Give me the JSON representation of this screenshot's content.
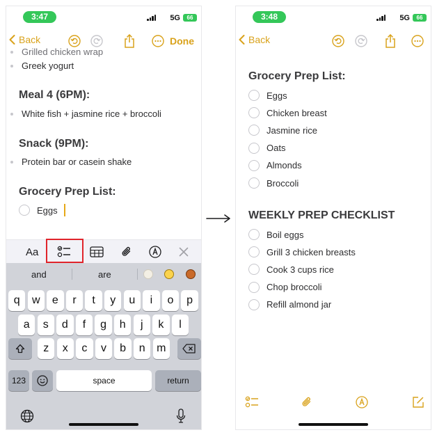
{
  "left": {
    "status": {
      "time": "3:47",
      "network": "5G",
      "battery": "66"
    },
    "nav": {
      "back": "Back",
      "done": "Done"
    },
    "bullets_top": [
      "Grilled chicken wrap",
      "Greek yogurt"
    ],
    "meal4": {
      "heading": "Meal 4 (6PM):",
      "bullet": "White fish + jasmine rice + broccoli"
    },
    "snack": {
      "heading": "Snack (9PM):",
      "bullet": "Protein bar or casein shake"
    },
    "grocery": {
      "heading": "Grocery Prep List:",
      "items": [
        "Eggs"
      ]
    },
    "format_bar": {
      "aa": "Aa"
    },
    "keyboard": {
      "suggestions": [
        "and",
        "are"
      ],
      "row1": [
        "q",
        "w",
        "e",
        "r",
        "t",
        "y",
        "u",
        "i",
        "o",
        "p"
      ],
      "row2": [
        "a",
        "s",
        "d",
        "f",
        "g",
        "h",
        "j",
        "k",
        "l"
      ],
      "row3": [
        "z",
        "x",
        "c",
        "v",
        "b",
        "n",
        "m"
      ],
      "num_key": "123",
      "space": "space",
      "return": "return"
    }
  },
  "right": {
    "status": {
      "time": "3:48",
      "network": "5G",
      "battery": "66"
    },
    "nav": {
      "back": "Back"
    },
    "grocery": {
      "heading": "Grocery Prep List:",
      "items": [
        "Eggs",
        "Chicken breast",
        "Jasmine rice",
        "Oats",
        "Almonds",
        "Broccoli"
      ]
    },
    "weekly": {
      "heading": "WEEKLY PREP CHECKLIST",
      "items": [
        "Boil eggs",
        "Grill 3 chicken breasts",
        "Cook 3 cups rice",
        "Chop broccoli",
        "Refill almond jar"
      ]
    }
  },
  "colors": {
    "accent": "#d9a21b",
    "highlight": "#e0242b",
    "status_green": "#34c759"
  },
  "icons": [
    "chevron-left-icon",
    "undo-icon",
    "redo-icon",
    "share-icon",
    "more-icon",
    "checklist-icon",
    "table-icon",
    "paperclip-icon",
    "markup-icon",
    "close-icon",
    "shift-icon",
    "delete-icon",
    "emoji-icon",
    "globe-icon",
    "mic-icon",
    "compose-icon",
    "arrow-right-icon"
  ]
}
